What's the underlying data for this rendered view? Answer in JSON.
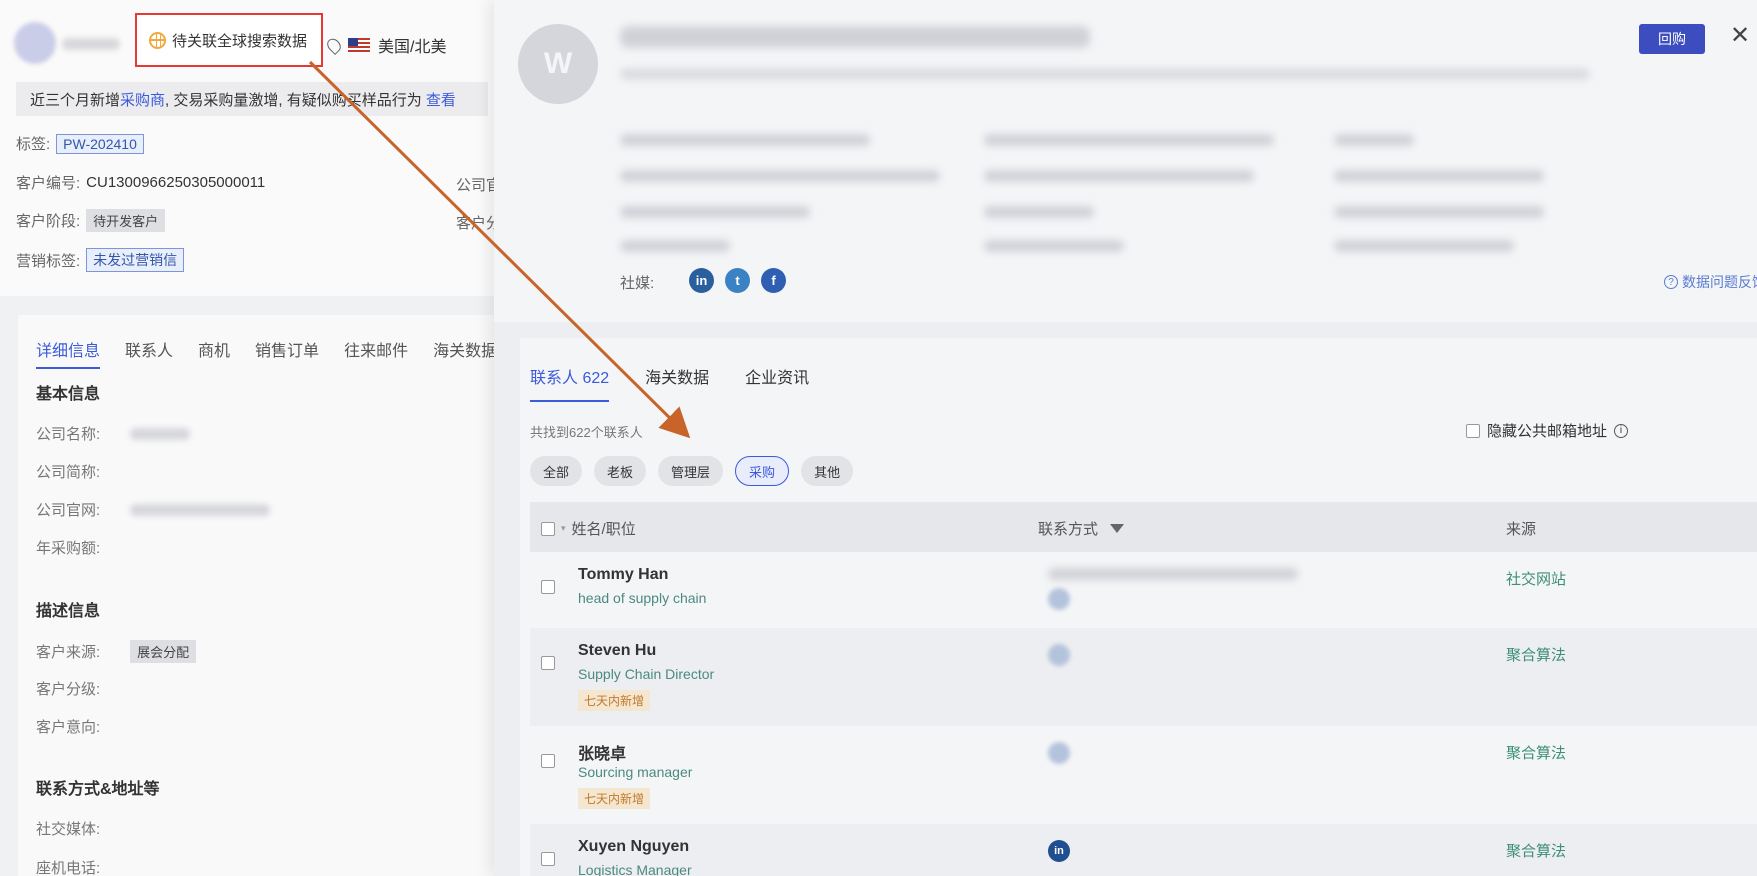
{
  "header": {
    "highlight_label": "待关联全球搜索数据",
    "location": "美国/北美"
  },
  "notice": {
    "prefix": "近三个月新增",
    "link_buyer": "采购商",
    "middle": ", 交易采购量激增, 有疑似购买样品行为 ",
    "link_view": "查看"
  },
  "info": {
    "tag_label": "标签:",
    "tag_value": "PW-202410",
    "customer_no_label": "客户编号:",
    "customer_no": "CU1300966250305000011",
    "company_label_cut": "公司官",
    "stage_label": "客户阶段:",
    "stage_value": "待开发客户",
    "source_label_cut": "客户分",
    "marketing_label": "营销标签:",
    "marketing_value": "未发过营销信"
  },
  "left_tabs": [
    "详细信息",
    "联系人",
    "商机",
    "销售订单",
    "往来邮件",
    "海关数据"
  ],
  "basic": {
    "title": "基本信息",
    "company_name": "公司名称:",
    "company_short": "公司简称:",
    "company_site": "公司官网:",
    "annual_purchase": "年采购额:"
  },
  "desc": {
    "title": "描述信息",
    "source": "客户来源:",
    "source_value": "展会分配",
    "grade": "客户分级:",
    "intent": "客户意向:"
  },
  "contact_section": {
    "title": "联系方式&地址等",
    "social": "社交媒体:",
    "phone": "座机电话:"
  },
  "drawer": {
    "logo_text": "W",
    "reply": "回购",
    "close": "✕",
    "social_label": "社媒:",
    "feedback": "数据问题反馈",
    "tabs": [
      "联系人 622",
      "海关数据",
      "企业资讯"
    ],
    "found": "共找到622个联系人",
    "hide_email": "隐藏公共邮箱地址",
    "chips": [
      "全部",
      "老板",
      "管理层",
      "采购",
      "其他"
    ],
    "active_chip": "采购",
    "columns": {
      "name": "姓名/职位",
      "contact": "联系方式",
      "source": "来源"
    }
  },
  "contacts": [
    {
      "name": "Tommy Han",
      "title": "head of supply chain",
      "tag": "",
      "source": "社交网站"
    },
    {
      "name": "Steven Hu",
      "title": "Supply Chain Director",
      "tag": "七天内新增",
      "source": "聚合算法"
    },
    {
      "name": "张晓卓",
      "title": "Sourcing manager",
      "tag": "七天内新增",
      "source": "聚合算法"
    },
    {
      "name": "Xuyen Nguyen",
      "title": "Logistics Manager",
      "tag": "",
      "source": "聚合算法"
    }
  ],
  "colors": {
    "accent": "#3b5bdb",
    "highlight_border": "#e53935",
    "arrow": "#c8642a",
    "source_text": "#3e8f74",
    "title_text": "#4b8a80"
  }
}
